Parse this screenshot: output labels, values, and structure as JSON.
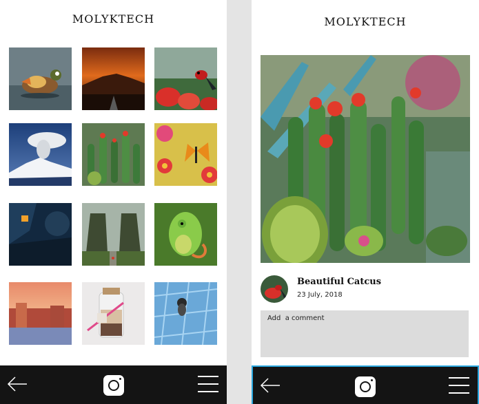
{
  "left_screen": {
    "app_title": "MOLYKTECH",
    "gallery": [
      {
        "icon": "mandarin-duck-photo"
      },
      {
        "icon": "volcano-sunset-photo"
      },
      {
        "icon": "red-bird-on-flowers-photo"
      },
      {
        "icon": "volcano-eruption-photo"
      },
      {
        "icon": "cactus-garden-photo"
      },
      {
        "icon": "butterfly-on-flowers-photo"
      },
      {
        "icon": "night-lantern-house-photo"
      },
      {
        "icon": "temple-gate-photo"
      },
      {
        "icon": "chameleon-photo"
      },
      {
        "icon": "venice-city-photo"
      },
      {
        "icon": "dessert-jar-photo"
      },
      {
        "icon": "aerial-pool-photo"
      }
    ],
    "nav": {
      "back_icon": "back-arrow-icon",
      "camera_icon": "camera-icon",
      "menu_icon": "hamburger-menu-icon"
    }
  },
  "right_screen": {
    "app_title": "MOLYKTECH",
    "post": {
      "image_icon": "cactus-garden-photo",
      "avatar_icon": "red-bird-avatar",
      "title": "Beautiful Catcus",
      "date": "23 July, 2018"
    },
    "comment": {
      "placeholder": "Add  a comment"
    },
    "nav": {
      "back_icon": "back-arrow-icon",
      "camera_icon": "camera-icon",
      "menu_icon": "hamburger-menu-icon"
    }
  },
  "colors": {
    "bottom_bar": "#141414",
    "accent_border": "#2aa8e0",
    "comment_bg": "#dcdcdc",
    "page_bg": "#e4e4e4"
  }
}
